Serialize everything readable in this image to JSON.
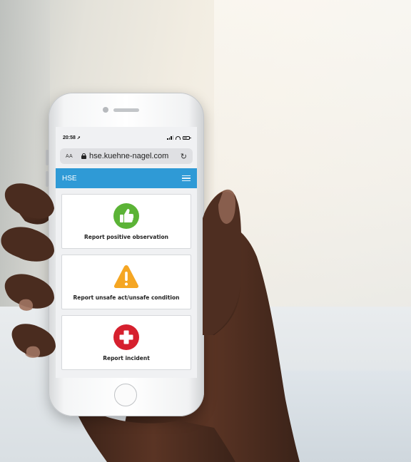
{
  "status_bar": {
    "time": "20:58"
  },
  "browser": {
    "text_size_label": "AA",
    "url": "hse.kuehne-nagel.com",
    "reload_symbol": "↻"
  },
  "app": {
    "title": "HSE",
    "colors": {
      "header": "#2f9ad6",
      "positive": "#5bb336",
      "warning": "#f5a623",
      "incident": "#d6202e"
    },
    "cards": [
      {
        "label": "Report positive observation",
        "icon": "thumbs-up-icon"
      },
      {
        "label": "Report unsafe act/unsafe condition",
        "icon": "warning-triangle-icon"
      },
      {
        "label": "Report incident",
        "icon": "medical-cross-icon"
      }
    ]
  }
}
